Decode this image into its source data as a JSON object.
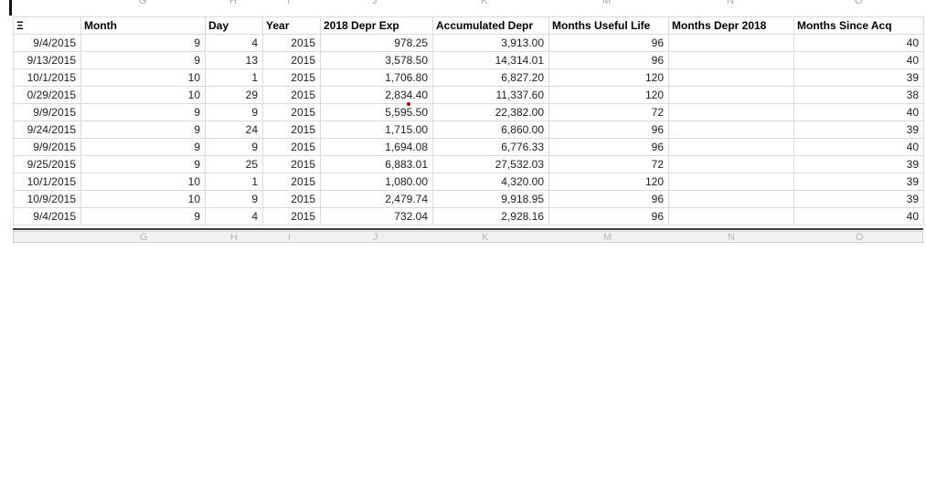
{
  "colors": {
    "background": "#ffffff",
    "grid": "#d9d9d9",
    "text": "#1d1d1d",
    "header_text": "#000000",
    "ghost_letters": "#a8a8a8",
    "strip_bg": "#f1f1f1",
    "split_bar": "#3c3c3c",
    "comment_dot": "#c00000",
    "cursor": "#111111"
  },
  "column_letters": {
    "letters": [
      "G",
      "H",
      "I",
      "J",
      "K",
      "M",
      "N",
      "O"
    ],
    "centers": [
      156,
      255,
      318,
      411,
      530,
      663,
      799,
      939
    ]
  },
  "table": {
    "first_header_fragment": "Ξ",
    "headers": [
      "Month",
      "Day",
      "Year",
      "2018 Depr Exp",
      "Accumulated Depr",
      "Months Useful Life",
      "Months Depr 2018",
      "Months Since Acq"
    ],
    "rows": [
      {
        "date": "9/4/2015",
        "month": "9",
        "day": "4",
        "year": "2015",
        "depr_exp": "978.25",
        "accum_depr": "3,913.00",
        "useful_life": "96",
        "months_depr_2018": "",
        "months_since_acq": "40"
      },
      {
        "date": "9/13/2015",
        "month": "9",
        "day": "13",
        "year": "2015",
        "depr_exp": "3,578.50",
        "accum_depr": "14,314.01",
        "useful_life": "96",
        "months_depr_2018": "",
        "months_since_acq": "40"
      },
      {
        "date": "10/1/2015",
        "month": "10",
        "day": "1",
        "year": "2015",
        "depr_exp": "1,706.80",
        "accum_depr": "6,827.20",
        "useful_life": "120",
        "months_depr_2018": "",
        "months_since_acq": "39"
      },
      {
        "date": "0/29/2015",
        "month": "10",
        "day": "29",
        "year": "2015",
        "depr_exp": "2,834.40",
        "accum_depr": "11,337.60",
        "useful_life": "120",
        "months_depr_2018": "",
        "months_since_acq": "38"
      },
      {
        "date": "9/9/2015",
        "month": "9",
        "day": "9",
        "year": "2015",
        "depr_exp": "5,595.50",
        "accum_depr": "22,382.00",
        "useful_life": "72",
        "months_depr_2018": "",
        "months_since_acq": "40"
      },
      {
        "date": "9/24/2015",
        "month": "9",
        "day": "24",
        "year": "2015",
        "depr_exp": "1,715.00",
        "accum_depr": "6,860.00",
        "useful_life": "96",
        "months_depr_2018": "",
        "months_since_acq": "39"
      },
      {
        "date": "9/9/2015",
        "month": "9",
        "day": "9",
        "year": "2015",
        "depr_exp": "1,694.08",
        "accum_depr": "6,776.33",
        "useful_life": "96",
        "months_depr_2018": "",
        "months_since_acq": "40"
      },
      {
        "date": "9/25/2015",
        "month": "9",
        "day": "25",
        "year": "2015",
        "depr_exp": "6,883.01",
        "accum_depr": "27,532.03",
        "useful_life": "72",
        "months_depr_2018": "",
        "months_since_acq": "39"
      },
      {
        "date": "10/1/2015",
        "month": "10",
        "day": "1",
        "year": "2015",
        "depr_exp": "1,080.00",
        "accum_depr": "4,320.00",
        "useful_life": "120",
        "months_depr_2018": "",
        "months_since_acq": "39"
      },
      {
        "date": "10/9/2015",
        "month": "10",
        "day": "9",
        "year": "2015",
        "depr_exp": "2,479.74",
        "accum_depr": "9,918.95",
        "useful_life": "96",
        "months_depr_2018": "",
        "months_since_acq": "39"
      },
      {
        "date": "9/4/2015",
        "month": "9",
        "day": "4",
        "year": "2015",
        "depr_exp": "732.04",
        "accum_depr": "2,928.16",
        "useful_life": "96",
        "months_depr_2018": "",
        "months_since_acq": "40"
      }
    ]
  }
}
